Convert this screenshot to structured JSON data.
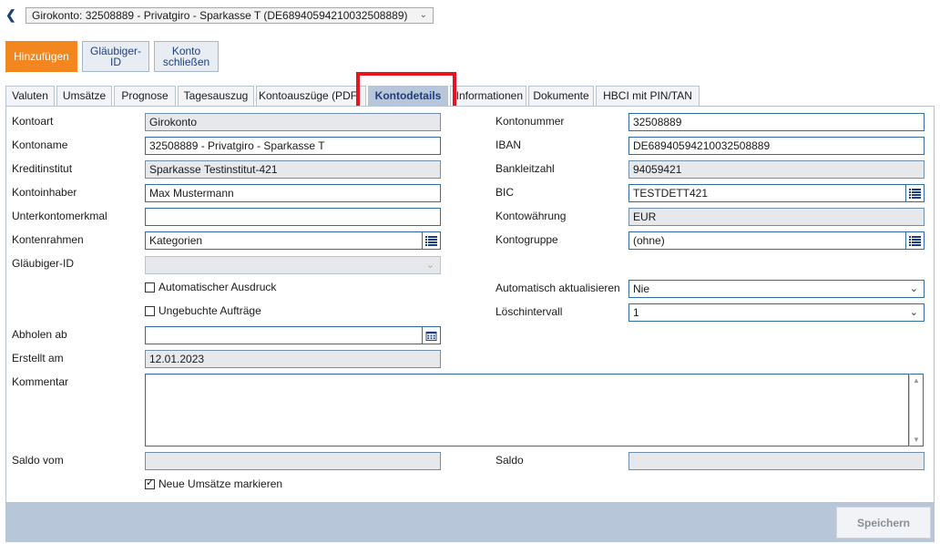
{
  "header": {
    "back_icon": "chevron-left-icon",
    "account_select": "Girokonto: 32508889 - Privatgiro - Sparkasse T (DE68940594210032508889)"
  },
  "actions": {
    "add": "Hinzufügen",
    "glaeubiger_line1": "Gläubiger-",
    "glaeubiger_line2": "ID",
    "close_line1": "Konto",
    "close_line2": "schließen"
  },
  "tabs": [
    {
      "label": "Valuten"
    },
    {
      "label": "Umsätze"
    },
    {
      "label": "Prognose"
    },
    {
      "label": "Tagesauszug"
    },
    {
      "label": "Kontoauszüge (PDF"
    },
    {
      "label": "Kontodetails"
    },
    {
      "label": "Informationen"
    },
    {
      "label": "Dokumente"
    },
    {
      "label": "HBCI mit PIN/TAN"
    }
  ],
  "active_tab": "Kontodetails",
  "form": {
    "kontoart": {
      "label": "Kontoart",
      "value": "Girokonto"
    },
    "kontoname": {
      "label": "Kontoname",
      "value": "32508889 - Privatgiro - Sparkasse T"
    },
    "kreditinstitut": {
      "label": "Kreditinstitut",
      "value": "Sparkasse Testinstitut-421"
    },
    "kontoinhaber": {
      "label": "Kontoinhaber",
      "value": "Max Mustermann"
    },
    "unterkontomerkmal": {
      "label": "Unterkontomerkmal",
      "value": ""
    },
    "kontenrahmen": {
      "label": "Kontenrahmen",
      "value": "Kategorien"
    },
    "glaeubiger_id": {
      "label": "Gläubiger-ID",
      "value": ""
    },
    "auto_ausdruck": {
      "label": "Automatischer Ausdruck",
      "checked": false
    },
    "ungebuchte": {
      "label": "Ungebuchte Aufträge",
      "checked": false
    },
    "abholen_ab": {
      "label": "Abholen ab",
      "value": ""
    },
    "erstellt_am": {
      "label": "Erstellt am",
      "value": "12.01.2023"
    },
    "kommentar": {
      "label": "Kommentar",
      "value": ""
    },
    "saldo_vom": {
      "label": "Saldo vom",
      "value": ""
    },
    "neue_umsaetze": {
      "label": "Neue Umsätze markieren",
      "checked": true
    },
    "kontonummer": {
      "label": "Kontonummer",
      "value": "32508889"
    },
    "iban": {
      "label": "IBAN",
      "value": "DE68940594210032508889"
    },
    "bankleitzahl": {
      "label": "Bankleitzahl",
      "value": "94059421"
    },
    "bic": {
      "label": "BIC",
      "value": "TESTDETT421"
    },
    "kontowaehrung": {
      "label": "Kontowährung",
      "value": "EUR"
    },
    "kontogruppe": {
      "label": "Kontogruppe",
      "value": "(ohne)"
    },
    "auto_aktualisieren": {
      "label": "Automatisch aktualisieren",
      "value": "Nie"
    },
    "loeschintervall": {
      "label": "Löschintervall",
      "value": "1"
    },
    "saldo": {
      "label": "Saldo",
      "value": ""
    }
  },
  "footer": {
    "save": "Speichern"
  },
  "colors": {
    "accent": "#f4861f",
    "highlight": "#e8141c",
    "tab_active": "#b8c6da"
  }
}
